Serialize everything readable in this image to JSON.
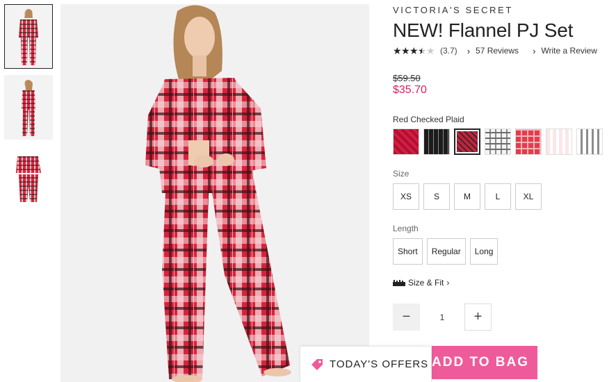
{
  "product": {
    "brand": "VICTORIA'S SECRET",
    "title": "NEW! Flannel PJ Set",
    "rating_value": "(3.7)",
    "reviews_label": "57 Reviews",
    "write_review_label": "Write a Review",
    "price_original": "$59.50",
    "price_sale": "$35.70"
  },
  "color": {
    "selected_name": "Red Checked Plaid",
    "swatches": [
      {
        "name": "red-solid-plaid",
        "colors": [
          "#b0102f",
          "#d21e45"
        ]
      },
      {
        "name": "black-stripe",
        "colors": [
          "#1c1c1c",
          "#8a8a8a"
        ]
      },
      {
        "name": "red-checked-plaid",
        "colors": [
          "#c5213b",
          "#2b2b2b"
        ]
      },
      {
        "name": "white-check",
        "colors": [
          "#f4f4f4",
          "#6b6b6b"
        ]
      },
      {
        "name": "red-tartan",
        "colors": [
          "#e53b4d",
          "#f6b3b8"
        ]
      },
      {
        "name": "pink-stripe",
        "colors": [
          "#fbe6e9",
          "#ffffff"
        ]
      },
      {
        "name": "grey-stripe",
        "colors": [
          "#ffffff",
          "#8c8c8c"
        ]
      }
    ]
  },
  "size": {
    "label": "Size",
    "options": [
      "XS",
      "S",
      "M",
      "L",
      "XL"
    ]
  },
  "length": {
    "label": "Length",
    "options": [
      "Short",
      "Regular",
      "Long"
    ]
  },
  "size_fit": {
    "label": "Size & Fit",
    "arrow": "›",
    "icon": "ruler-icon"
  },
  "quantity": {
    "value": "1",
    "minus": "−",
    "plus": "+"
  },
  "cta": {
    "add_to_bag": "ADD TO BAG",
    "offers": "TODAY'S OFFERS"
  },
  "colors": {
    "accent_pink": "#ee5b9a",
    "sale_red": "#d6245e"
  }
}
